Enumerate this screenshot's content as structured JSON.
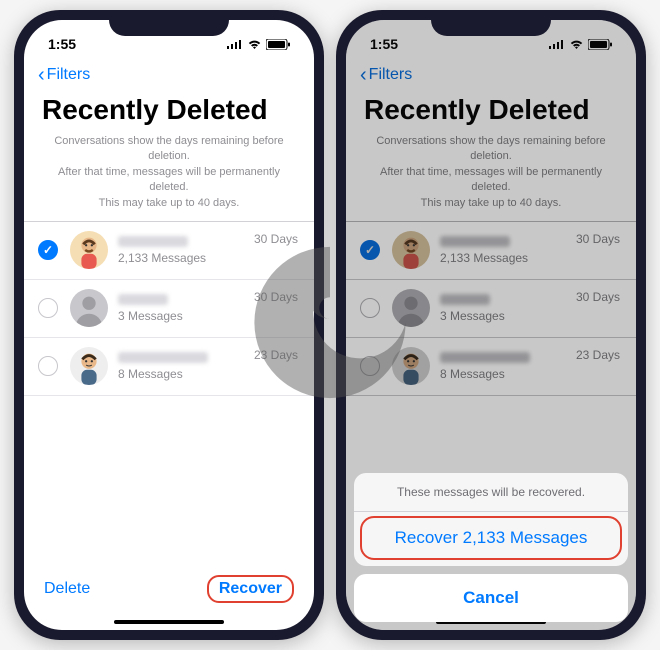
{
  "status": {
    "time": "1:55"
  },
  "nav": {
    "back": "Filters"
  },
  "title": "Recently Deleted",
  "info": {
    "line1": "Conversations show the days remaining before deletion.",
    "line2": "After that time, messages will be permanently deleted.",
    "line3": "This may take up to 40 days."
  },
  "rows": [
    {
      "count": "2,133 Messages",
      "days": "30 Days",
      "checked": true,
      "avatar": "memoji1"
    },
    {
      "count": "3 Messages",
      "days": "30 Days",
      "checked": false,
      "avatar": "placeholder"
    },
    {
      "count": "8 Messages",
      "days": "23 Days",
      "checked": false,
      "avatar": "memoji2"
    }
  ],
  "toolbar": {
    "delete": "Delete",
    "recover": "Recover"
  },
  "sheet": {
    "message": "These messages will be recovered.",
    "primary": "Recover 2,133 Messages",
    "cancel": "Cancel"
  }
}
